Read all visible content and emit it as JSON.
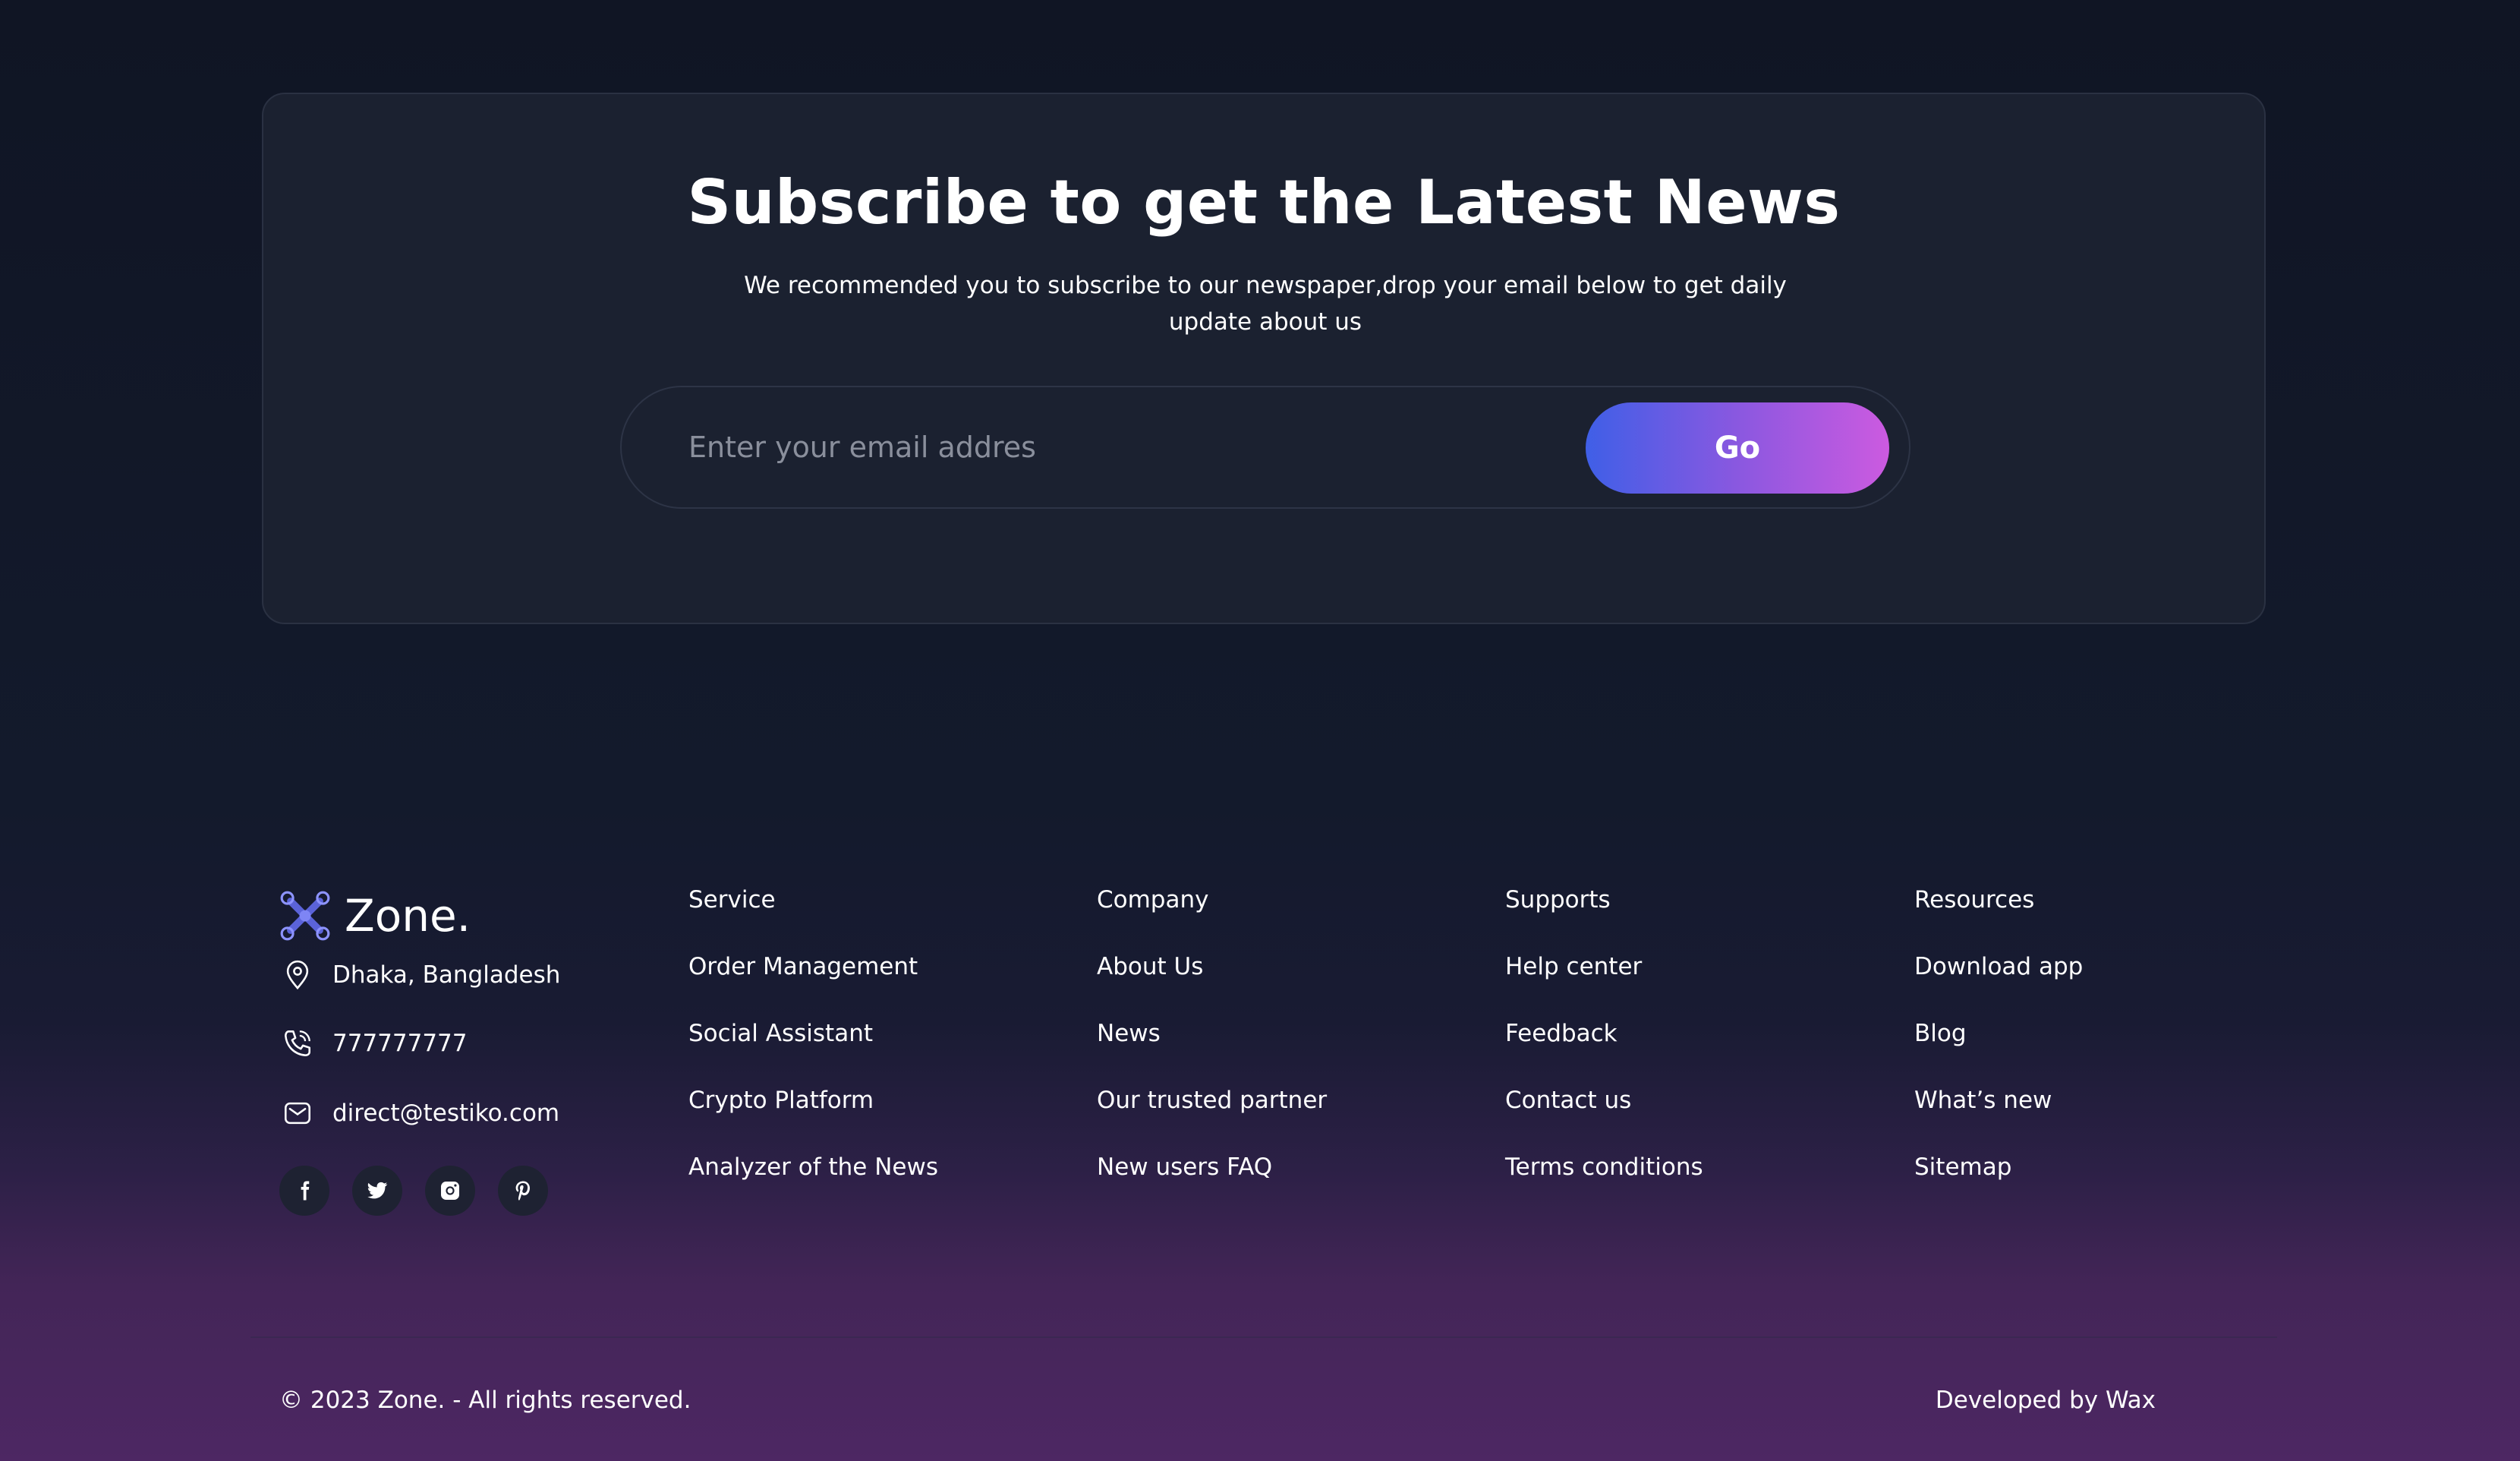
{
  "subscribe": {
    "title": "Subscribe to get the Latest News",
    "description": "We recommended you to subscribe to our newspaper,drop your email below to get daily update about us",
    "email_placeholder": "Enter your email addres",
    "button_label": "Go",
    "button_gradient": [
      "#3f5fe7",
      "#cc5ae0"
    ]
  },
  "brand": {
    "name": "Zone.",
    "logo_icon": "drone-x-icon",
    "logo_color": "#5b63d9"
  },
  "contact": {
    "address": "Dhaka, Bangladesh",
    "phone": "777777777",
    "email": "direct@testiko.com"
  },
  "socials": [
    "facebook-icon",
    "twitter-icon",
    "instagram-icon",
    "pinterest-icon"
  ],
  "columns": [
    {
      "heading": "Service",
      "links": [
        "Order Management",
        "Social Assistant",
        "Crypto Platform",
        "Analyzer of the News"
      ]
    },
    {
      "heading": "Company",
      "links": [
        "About Us",
        "News",
        "Our trusted partner",
        "New users FAQ"
      ]
    },
    {
      "heading": "Supports",
      "links": [
        "Help center",
        "Feedback",
        "Contact us",
        "Terms conditions"
      ]
    },
    {
      "heading": "Resources",
      "links": [
        "Download app",
        "Blog",
        "What’s new",
        "Sitemap"
      ]
    }
  ],
  "footer": {
    "copyright": "© 2023 Zone. - All rights reserved.",
    "developed_by": "Developed by Wax"
  }
}
